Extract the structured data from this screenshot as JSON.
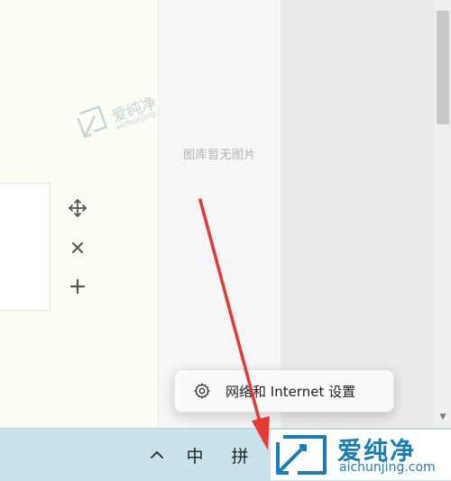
{
  "gallery": {
    "empty_text": "图库暂无图片"
  },
  "tools": {
    "move_icon": "move-icon",
    "close_icon": "close-icon",
    "add_icon": "plus-icon"
  },
  "popup": {
    "icon": "gear-icon",
    "label": "网络和 Internet 设置"
  },
  "taskbar": {
    "chevron_icon": "chevron-up-icon",
    "ime_mode": "中",
    "ime_type": "拼"
  },
  "watermark": {
    "brand": "爱纯净",
    "domain": "aichunjing.com"
  },
  "colors": {
    "taskbar": "#c9e2ea",
    "editor_bg": "#fdfcf3",
    "gallery_bg": "#f6f6f6",
    "arrow": "#e53935",
    "brand": "#1a7db6"
  }
}
